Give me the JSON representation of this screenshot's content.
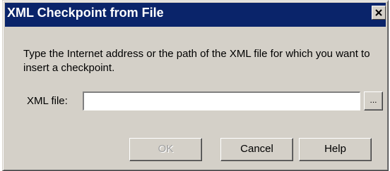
{
  "window": {
    "title": "XML Checkpoint from File",
    "close_icon": "close-icon"
  },
  "main": {
    "prompt": "Type the Internet address or the path of the XML file for which you want to insert a checkpoint.",
    "xml_file_label": "XML file:",
    "xml_file_value": "",
    "browse_label": "..."
  },
  "buttons": {
    "ok_label": "OK",
    "ok_enabled": false,
    "cancel_label": "Cancel",
    "help_label": "Help"
  },
  "colors": {
    "title_bar": "#0a246a",
    "dialog_face": "#d4d0c8",
    "disabled_text": "#a0a0a0"
  }
}
